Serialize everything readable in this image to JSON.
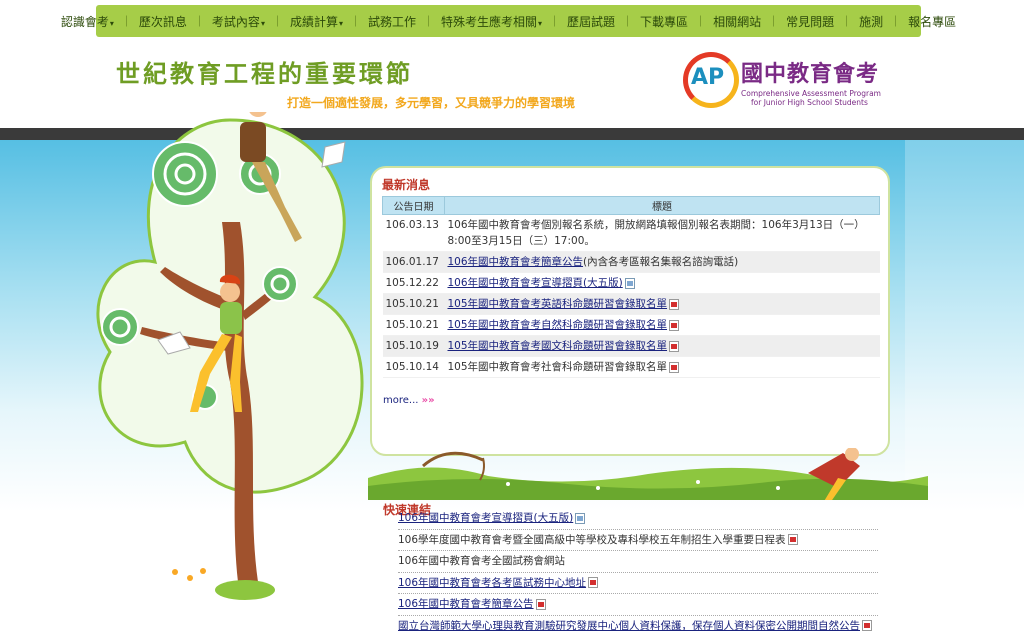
{
  "nav": {
    "items": [
      {
        "label": "認識會考",
        "dropdown": true
      },
      {
        "label": "歷次訊息",
        "dropdown": false
      },
      {
        "label": "考試內容",
        "dropdown": true
      },
      {
        "label": "成績計算",
        "dropdown": true
      },
      {
        "label": "試務工作",
        "dropdown": false
      },
      {
        "label": "特殊考生應考相關",
        "dropdown": true
      },
      {
        "label": "歷屆試題",
        "dropdown": false
      },
      {
        "label": "下載專區",
        "dropdown": false
      },
      {
        "label": "相關網站",
        "dropdown": false
      },
      {
        "label": "常見問題",
        "dropdown": false
      },
      {
        "label": "施測",
        "dropdown": false
      },
      {
        "label": "報名專區",
        "dropdown": false
      }
    ],
    "caret": "▾",
    "separator": "｜"
  },
  "header": {
    "slogan_main": "世紀教育工程的重要環節",
    "slogan_sub": "打造一個適性發展，多元學習，又具競爭力的學習環境",
    "logo_mark": "AP",
    "logo_title": "國中教育會考",
    "logo_en_1": "Comprehensive Assessment Program",
    "logo_en_2": "for Junior High School Students"
  },
  "news": {
    "title": "最新消息",
    "col_date": "公告日期",
    "col_title": "標題",
    "rows": [
      {
        "date": "106.03.13",
        "title": "106年國中教育會考個別報名系統，開放網路填報個別報名表期間：106年3月13日（一）8:00至3月15日（三）17:00。",
        "link": false,
        "icon": ""
      },
      {
        "date": "106.01.17",
        "title": "106年國中教育會考簡章公告",
        "suffix": "(內含各考區報名集報名諮詢電話)",
        "link": true,
        "icon": ""
      },
      {
        "date": "105.12.22",
        "title": "106年國中教育會考宣導摺頁(大五版)",
        "link": true,
        "icon": "doc"
      },
      {
        "date": "105.10.21",
        "title": "105年國中教育會考英語科命題研習會錄取名單",
        "link": true,
        "icon": "pdf"
      },
      {
        "date": "105.10.21",
        "title": "105年國中教育會考自然科命題研習會錄取名單",
        "link": true,
        "icon": "pdf"
      },
      {
        "date": "105.10.19",
        "title": "105年國中教育會考國文科命題研習會錄取名單",
        "link": true,
        "icon": "pdf"
      },
      {
        "date": "105.10.14",
        "title": "105年國中教育會考社會科命題研習會錄取名單",
        "link": false,
        "icon": "pdf"
      }
    ],
    "more_label": "more...",
    "more_arrow": "»»"
  },
  "quick_links": {
    "title": "快速連結",
    "items": [
      {
        "label": "106年國中教育會考宣導摺頁(大五版)",
        "link": true,
        "icon": "doc"
      },
      {
        "label": "106學年度國中教育會考暨全國高級中等學校及專科學校五年制招生入學重要日程表",
        "link": false,
        "icon": "pdf"
      },
      {
        "label": "106年國中教育會考全國試務會網站",
        "link": false,
        "icon": ""
      },
      {
        "label": "106年國中教育會考各考區試務中心地址",
        "link": true,
        "icon": "pdf"
      },
      {
        "label": "106年國中教育會考簡章公告",
        "link": true,
        "icon": "pdf"
      },
      {
        "label": "國立台灣師範大學心理與教育測驗研究發展中心個人資料保護，保存個人資料保密公開期間自然公告",
        "link": true,
        "icon": "pdf"
      }
    ]
  }
}
